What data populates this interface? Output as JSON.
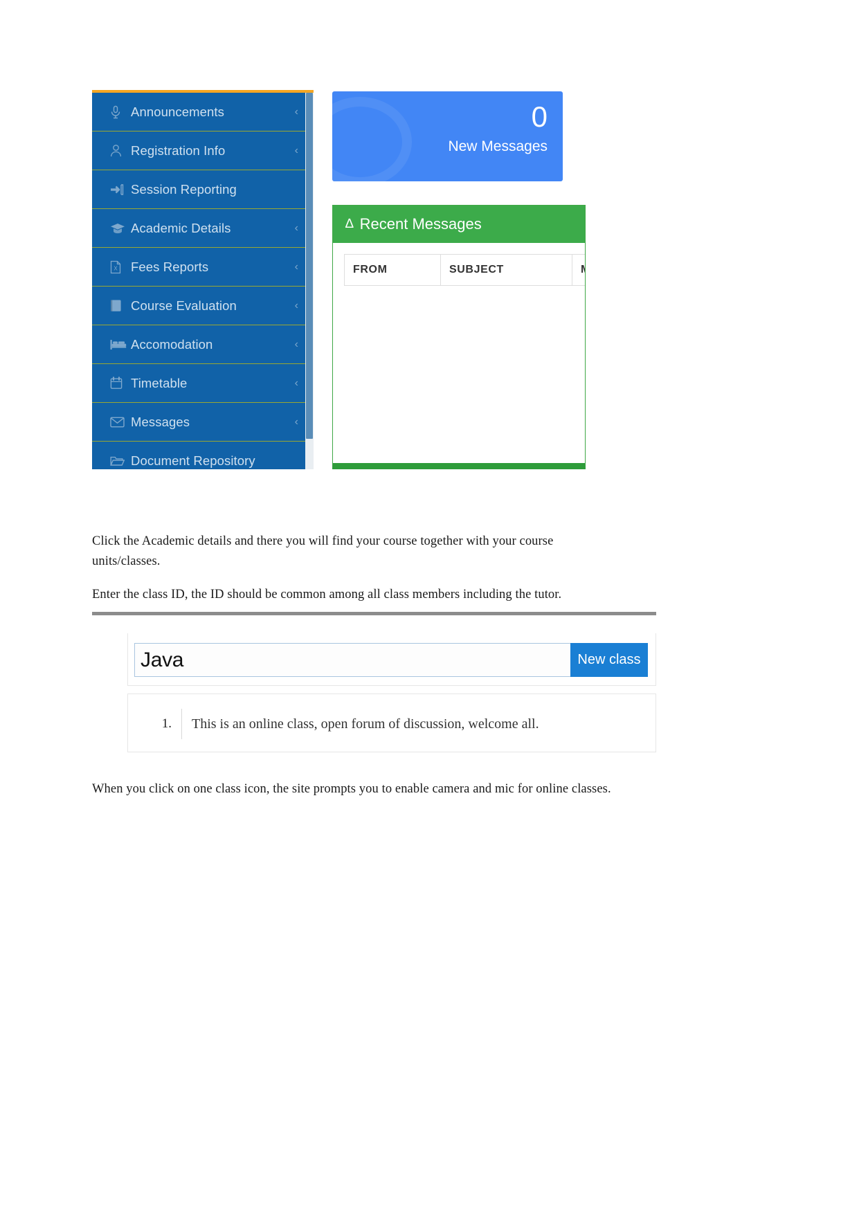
{
  "dashboard": {
    "sidebar": {
      "items": [
        {
          "label": "Announcements",
          "icon": "microphone-icon",
          "caret": "‹"
        },
        {
          "label": "Registration Info",
          "icon": "user-icon",
          "caret": "‹"
        },
        {
          "label": "Session Reporting",
          "icon": "sign-in-icon",
          "caret": ""
        },
        {
          "label": "Academic Details",
          "icon": "graduation-cap-icon",
          "caret": "‹"
        },
        {
          "label": "Fees Reports",
          "icon": "file-excel-icon",
          "caret": "‹"
        },
        {
          "label": "Course Evaluation",
          "icon": "book-icon",
          "caret": "‹"
        },
        {
          "label": "Accomodation",
          "icon": "bed-icon",
          "caret": "‹"
        },
        {
          "label": "Timetable",
          "icon": "calendar-icon",
          "caret": "‹"
        },
        {
          "label": "Messages",
          "icon": "envelope-icon",
          "caret": "‹"
        },
        {
          "label": "Document Repository",
          "icon": "folder-open-icon",
          "caret": ""
        }
      ]
    },
    "stat_card": {
      "count": "0",
      "label": "New Messages",
      "color": "#4286f5"
    },
    "recent_messages": {
      "title": "Recent Messages",
      "bell_icon": "∆",
      "accent_color": "#3cab4a",
      "columns": [
        "FROM",
        "SUBJECT",
        "M"
      ],
      "rows": []
    }
  },
  "body_text": {
    "paragraph1": "Click the Academic details and there you will find your course together with your course units/classes.",
    "paragraph2": "Enter the class ID, the ID should be common among all class members including the tutor.",
    "paragraph3": "When you click on one class icon, the site prompts you to enable camera and mic for online classes."
  },
  "class_form": {
    "input_value": "Java",
    "input_placeholder": "",
    "button_label": "New class",
    "button_color": "#1a7fd4",
    "list": [
      {
        "number": "1.",
        "text": "This is an online class, open forum of discussion, welcome all."
      }
    ]
  }
}
